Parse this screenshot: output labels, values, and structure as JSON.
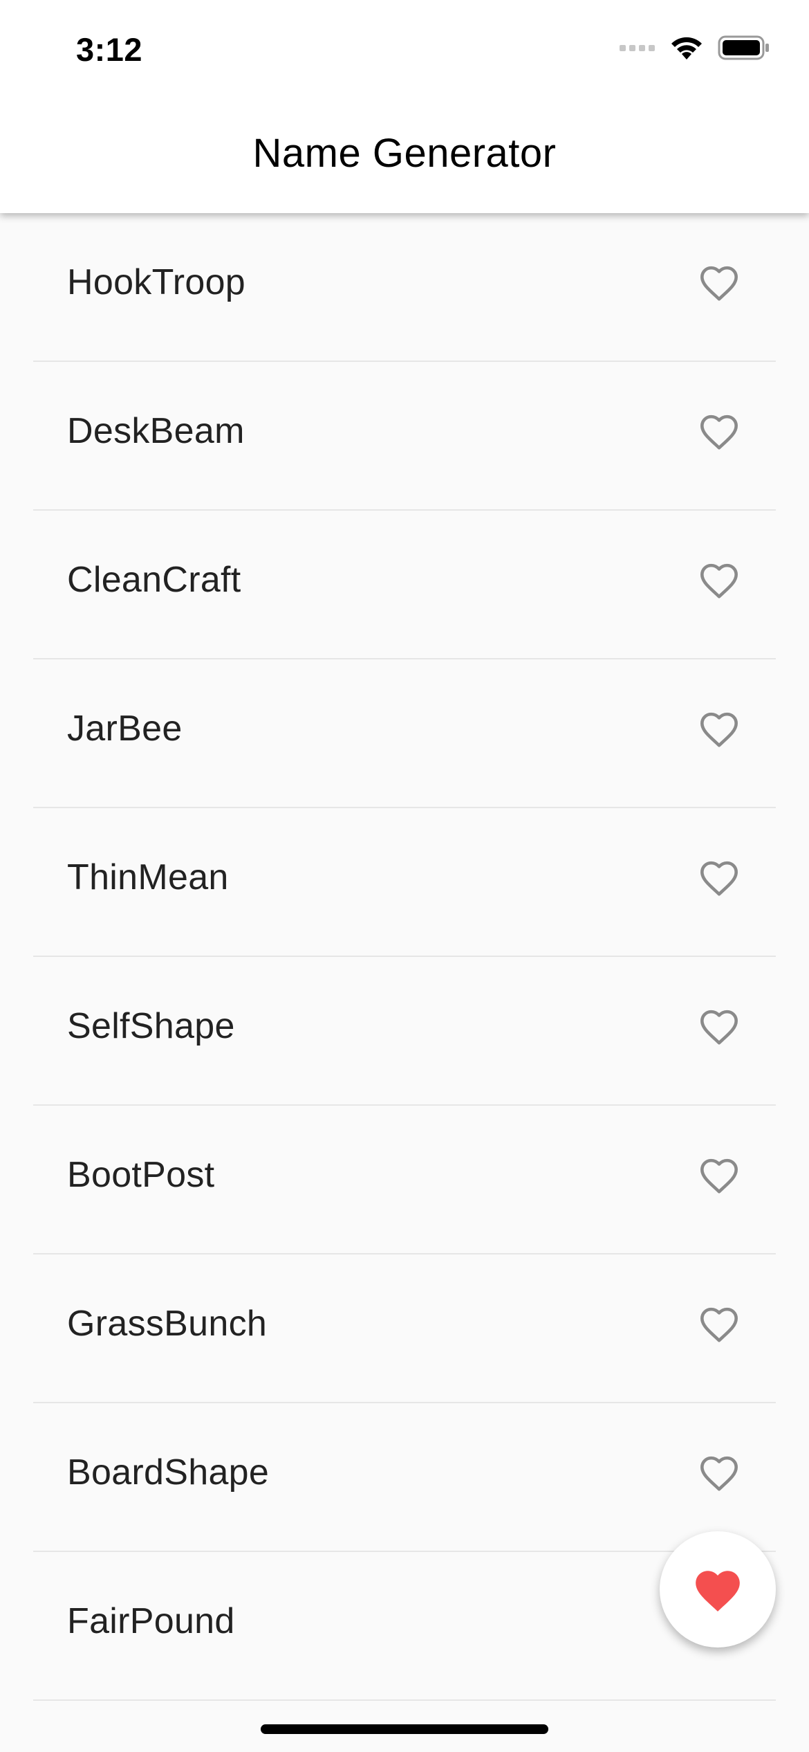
{
  "status_bar": {
    "time": "3:12",
    "icons": [
      "cellular-signal-icon",
      "wifi-icon",
      "battery-icon"
    ]
  },
  "app_bar": {
    "title": "Name Generator"
  },
  "list": {
    "items": [
      {
        "label": "HookTroop",
        "favorited": false
      },
      {
        "label": "DeskBeam",
        "favorited": false
      },
      {
        "label": "CleanCraft",
        "favorited": false
      },
      {
        "label": "JarBee",
        "favorited": false
      },
      {
        "label": "ThinMean",
        "favorited": false
      },
      {
        "label": "SelfShape",
        "favorited": false
      },
      {
        "label": "BootPost",
        "favorited": false
      },
      {
        "label": "GrassBunch",
        "favorited": false
      },
      {
        "label": "BoardShape",
        "favorited": false
      },
      {
        "label": "FairPound",
        "favorited": false
      }
    ],
    "heart_outline_color": "#8a8a8a"
  },
  "fab": {
    "icon": "heart-filled-icon",
    "color": "#f44f4f"
  }
}
